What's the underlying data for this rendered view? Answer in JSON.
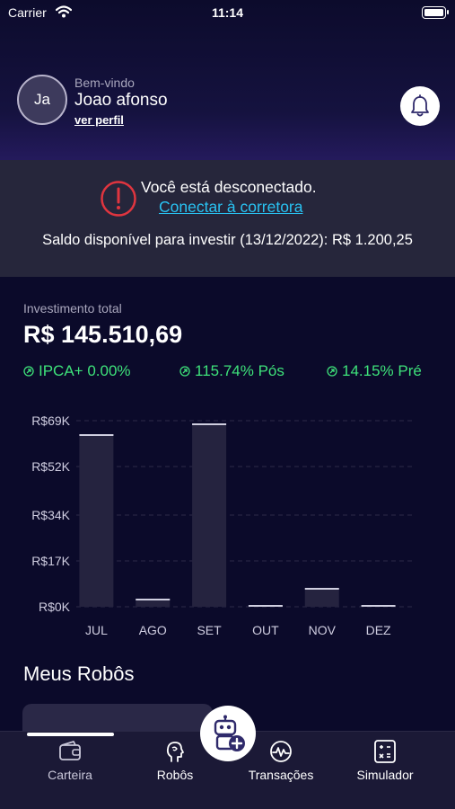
{
  "status": {
    "carrier": "Carrier",
    "time": "11:14"
  },
  "header": {
    "avatar_initials": "Ja",
    "welcome": "Bem-vindo",
    "username": "Joao afonso",
    "profile_link": "ver perfil",
    "bell_icon": "bell-icon"
  },
  "alert": {
    "icon": "exclamation-circle-icon",
    "accent": "#e0353f",
    "title": "Você está desconectado.",
    "link": "Conectar à corretora",
    "link_color": "#29c2f2",
    "balance": "Saldo disponível para investir (13/12/2022): R$ 1.200,25"
  },
  "investment": {
    "label": "Investimento total",
    "value": "R$ 145.510,69",
    "rates": [
      {
        "label": "IPCA+ 0.00%",
        "icon": "trend-arrow-icon"
      },
      {
        "label": "115.74% Pós",
        "icon": "trend-arrow-icon"
      },
      {
        "label": "14.15% Pré",
        "icon": "trend-arrow-icon"
      }
    ],
    "rate_color": "#3ee27a"
  },
  "chart_data": {
    "type": "bar",
    "categories": [
      "JUL",
      "AGO",
      "SET",
      "OUT",
      "NOV",
      "DEZ"
    ],
    "values": [
      64000,
      3000,
      68000,
      500,
      7000,
      0
    ],
    "ylim": [
      0,
      69000
    ],
    "yticks": [
      0,
      17000,
      34000,
      52000,
      69000
    ],
    "ytick_labels": [
      "R$0K",
      "R$17K",
      "R$34K",
      "R$52K",
      "R$69K"
    ],
    "grid": true,
    "bar_color": "#25233f",
    "bar_top_color": "#d0cfe0"
  },
  "robots": {
    "title": "Meus Robôs"
  },
  "tabbar": {
    "tabs": [
      {
        "label": "Carteira",
        "icon": "wallet-icon"
      },
      {
        "label": "Robôs",
        "icon": "head-profile-icon"
      },
      {
        "label": "Transações",
        "icon": "pulse-circle-icon"
      },
      {
        "label": "Simulador",
        "icon": "calculator-icon"
      }
    ],
    "fab_icon": "robot-add-icon"
  }
}
